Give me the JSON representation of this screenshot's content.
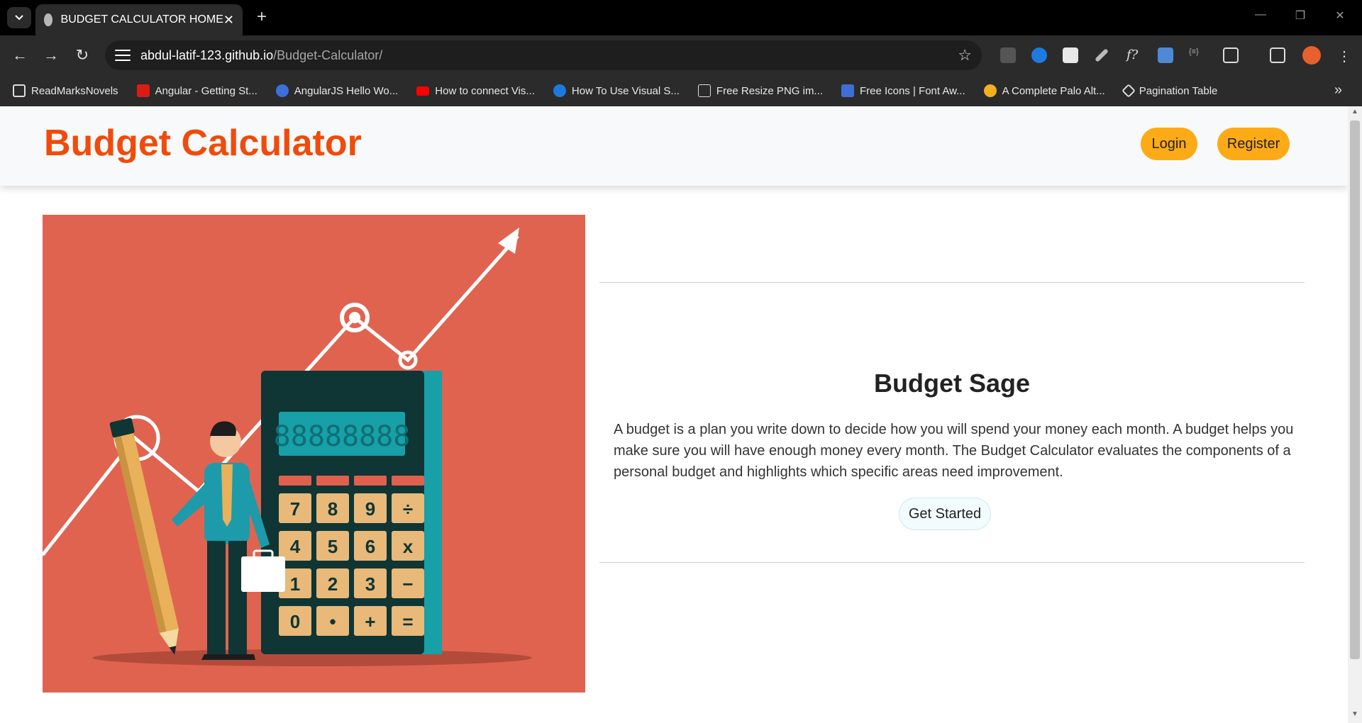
{
  "browser": {
    "tab_title": "BUDGET CALCULATOR HOME",
    "url_host": "abdul-latif-123.github.io",
    "url_path": "/Budget-Calculator/",
    "bookmarks": [
      "ReadMarksNovels",
      "Angular - Getting St...",
      "AngularJS Hello Wo...",
      "How to connect Vis...",
      "How To Use Visual S...",
      "Free Resize PNG im...",
      "Free Icons | Font Aw...",
      "A Complete Palo Alt...",
      "Pagination Table"
    ]
  },
  "navbar": {
    "brand": "Budget Calculator",
    "login": "Login",
    "register": "Register"
  },
  "hero": {
    "title": "Budget Sage",
    "text": "A budget is a plan you write down to decide how you will spend your money each month. A budget helps you make sure you will have enough money every month. The Budget Calculator evaluates the components of a personal budget and highlights which specific areas need improvement.",
    "cta": "Get Started"
  },
  "illustration": {
    "display": "88888888",
    "keys": [
      "7",
      "8",
      "9",
      "÷",
      "4",
      "5",
      "6",
      "x",
      "1",
      "2",
      "3",
      "−",
      "0",
      "•",
      "+",
      "="
    ]
  },
  "colors": {
    "brand": "#f04b0c",
    "button": "#fdaa17",
    "illustration_bg": "#e06350"
  }
}
